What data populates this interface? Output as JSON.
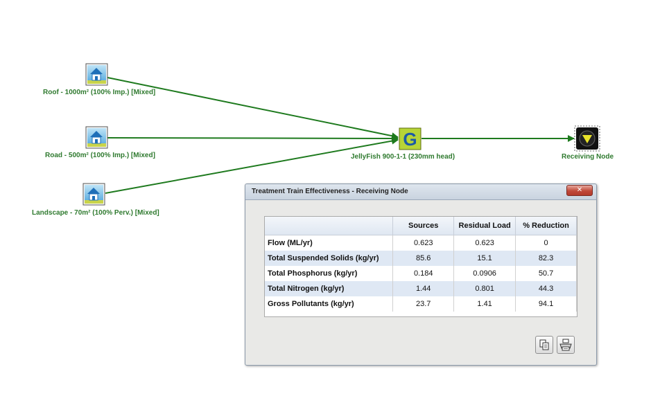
{
  "diagram": {
    "nodes": {
      "roof": {
        "label": "Roof - 1000m² (100% Imp.) [Mixed]",
        "icon": "urban-house-icon"
      },
      "road": {
        "label": "Road - 500m² (100% Imp.) [Mixed]",
        "icon": "urban-house-icon"
      },
      "landscape": {
        "label": "Landscape - 70m² (100% Perv.) [Mixed]",
        "icon": "urban-house-icon"
      },
      "jellyfish": {
        "label": "JellyFish 900-1-1 (230mm head)",
        "icon": "gpt-g-icon",
        "glyph": "G"
      },
      "receiving": {
        "label": "Receiving Node",
        "icon": "receiving-node-icon"
      }
    },
    "link_color": "#1e7a1e"
  },
  "dialog": {
    "title": "Treatment Train Effectiveness - Receiving Node",
    "close_glyph": "✕",
    "table": {
      "headers": [
        "",
        "Sources",
        "Residual Load",
        "% Reduction"
      ],
      "rows": [
        {
          "label": "Flow (ML/yr)",
          "sources": "0.623",
          "residual": "0.623",
          "reduction": "0"
        },
        {
          "label": "Total Suspended Solids (kg/yr)",
          "sources": "85.6",
          "residual": "15.1",
          "reduction": "82.3"
        },
        {
          "label": "Total Phosphorus (kg/yr)",
          "sources": "0.184",
          "residual": "0.0906",
          "reduction": "50.7"
        },
        {
          "label": "Total Nitrogen (kg/yr)",
          "sources": "1.44",
          "residual": "0.801",
          "reduction": "44.3"
        },
        {
          "label": "Gross Pollutants (kg/yr)",
          "sources": "23.7",
          "residual": "1.41",
          "reduction": "94.1"
        }
      ]
    },
    "buttons": {
      "copy": "copy-icon",
      "print": "printer-icon"
    }
  }
}
